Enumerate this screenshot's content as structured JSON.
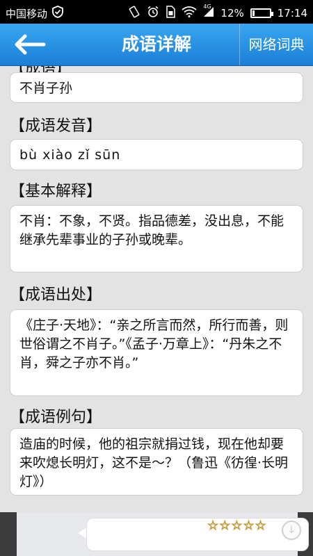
{
  "status_bar": {
    "carrier": "中国移动",
    "network_type": "4G",
    "battery": "12%",
    "battery_level": 0.12,
    "time": "17:14",
    "icons": [
      "shield-check-icon",
      "vibrate-icon",
      "alarm-icon",
      "sim-icon",
      "wifi-icon",
      "signal-icon",
      "battery-icon"
    ]
  },
  "header": {
    "title": "成语详解",
    "back_icon": "back-arrow-icon",
    "right_button": "网络词典"
  },
  "sections": {
    "cut_heading": "【成语】",
    "idiom_value": "不肖子孙",
    "pronunciation_heading": "【成语发音】",
    "pronunciation_value": "bù xiào zǐ sūn",
    "meaning_heading": "【基本解释】",
    "meaning_value": "不肖：不象，不贤。指品德差，没出息，不能继承先辈事业的子孙或晚辈。",
    "source_heading": "【成语出处】",
    "source_value": "《庄子·天地》：“亲之所言而然，所行而善，则世俗谓之不肖子。”《孟子·万章上》：“丹朱之不肖，舜之子亦不肖。”",
    "example_heading": "【成语例句】",
    "example_value": "造庙的时候，他的祖宗就捐过钱，现在他却要来吹熄长明灯，这不是～？（鲁迅《彷徨·长明灯》）"
  },
  "ad_bar": {
    "rating_stars": "☆☆☆☆☆",
    "rating_value": 0,
    "download_icon": "download-icon"
  },
  "colors": {
    "header_blue": "#1a7fd6",
    "background": "#e3e3e3",
    "card": "#ffffff"
  }
}
